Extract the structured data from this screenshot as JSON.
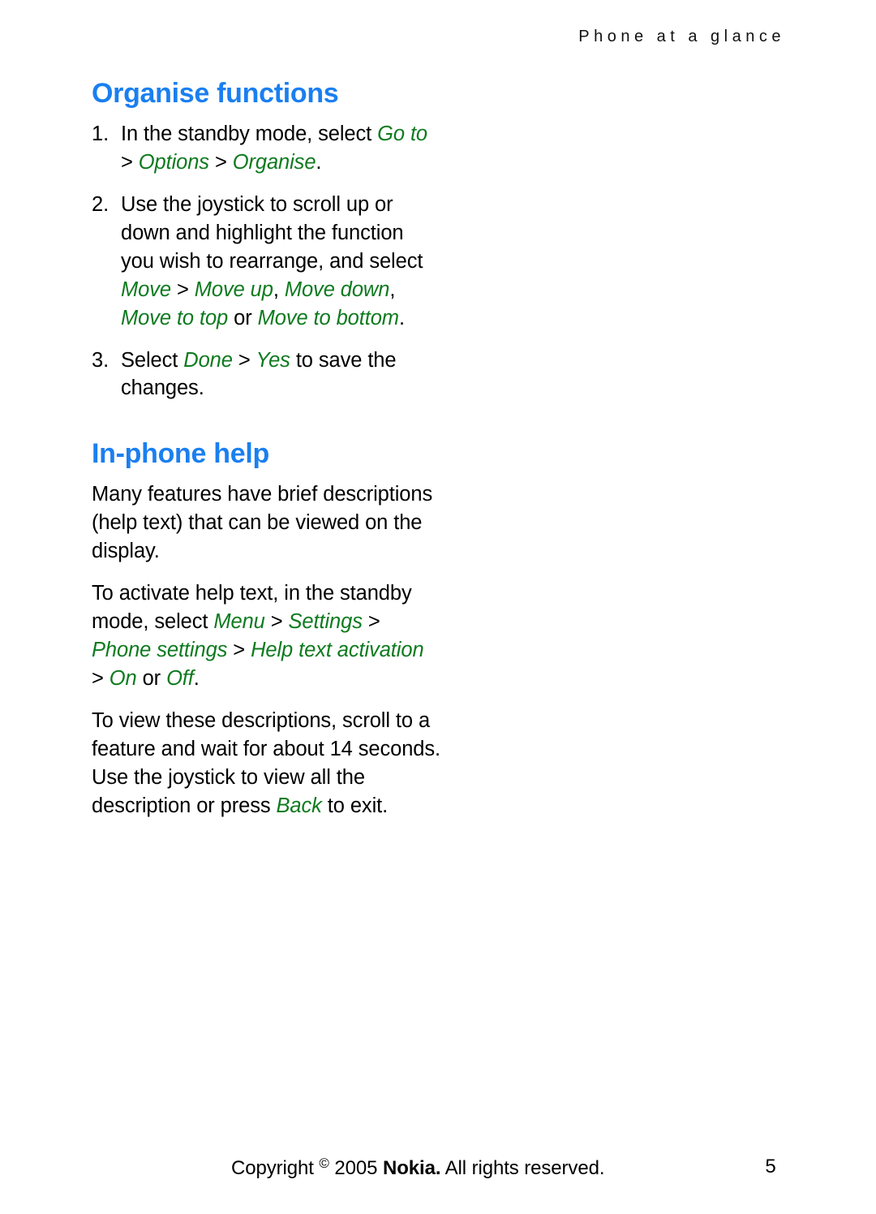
{
  "page": {
    "running_header": "Phone at a glance",
    "number": "5"
  },
  "sections": [
    {
      "title": "Organise functions",
      "steps": [
        {
          "number": "1.",
          "parts": [
            {
              "type": "text",
              "value": "In the standby mode, select "
            },
            {
              "type": "menu",
              "value": "Go to"
            },
            {
              "type": "sep",
              "value": " > "
            },
            {
              "type": "menu",
              "value": "Options"
            },
            {
              "type": "sep",
              "value": " > "
            },
            {
              "type": "menu",
              "value": "Organise"
            },
            {
              "type": "text",
              "value": "."
            }
          ]
        },
        {
          "number": "2.",
          "parts": [
            {
              "type": "text",
              "value": "Use the joystick to scroll up or down and highlight the function you wish to rearrange, and select "
            },
            {
              "type": "menu",
              "value": "Move"
            },
            {
              "type": "sep",
              "value": " > "
            },
            {
              "type": "menu",
              "value": "Move up"
            },
            {
              "type": "sep",
              "value": ", "
            },
            {
              "type": "menu",
              "value": "Move down"
            },
            {
              "type": "sep",
              "value": ", "
            },
            {
              "type": "menu",
              "value": "Move to top"
            },
            {
              "type": "sep",
              "value": " or "
            },
            {
              "type": "menu",
              "value": "Move to bottom"
            },
            {
              "type": "text",
              "value": "."
            }
          ]
        },
        {
          "number": "3.",
          "parts": [
            {
              "type": "text",
              "value": "Select "
            },
            {
              "type": "menu",
              "value": "Done"
            },
            {
              "type": "sep",
              "value": " > "
            },
            {
              "type": "menu",
              "value": "Yes"
            },
            {
              "type": "text",
              "value": " to save the changes."
            }
          ]
        }
      ]
    },
    {
      "title": "In-phone help",
      "paragraphs": [
        {
          "parts": [
            {
              "type": "text",
              "value": "Many features have brief descriptions (help text) that can be viewed on the display."
            }
          ]
        },
        {
          "parts": [
            {
              "type": "text",
              "value": "To activate help text, in the standby mode, select "
            },
            {
              "type": "menu",
              "value": "Menu"
            },
            {
              "type": "sep",
              "value": " > "
            },
            {
              "type": "menu",
              "value": "Settings"
            },
            {
              "type": "sep",
              "value": " > "
            },
            {
              "type": "menu",
              "value": "Phone settings"
            },
            {
              "type": "sep",
              "value": " > "
            },
            {
              "type": "menu",
              "value": "Help text activation"
            },
            {
              "type": "sep",
              "value": " > "
            },
            {
              "type": "menu",
              "value": "On"
            },
            {
              "type": "sep",
              "value": " or "
            },
            {
              "type": "menu",
              "value": "Off"
            },
            {
              "type": "text",
              "value": "."
            }
          ]
        },
        {
          "parts": [
            {
              "type": "text",
              "value": "To view these descriptions, scroll to a feature and wait for about 14 seconds. Use the joystick to view all the description or press "
            },
            {
              "type": "menu",
              "value": "Back"
            },
            {
              "type": "text",
              "value": " to exit."
            }
          ]
        }
      ]
    }
  ],
  "footer": {
    "copyright_prefix": "Copyright ",
    "copyright_symbol": "©",
    "copyright_year": " 2005 ",
    "brand": "Nokia.",
    "copyright_suffix": " All rights reserved."
  },
  "colors": {
    "heading_blue": "#1a7ff0",
    "menu_green": "#0d7a1e",
    "body_black": "#000000"
  }
}
